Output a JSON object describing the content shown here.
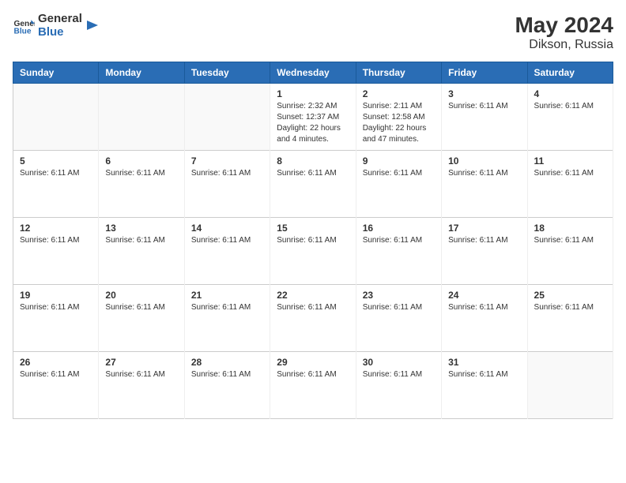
{
  "logo": {
    "text_general": "General",
    "text_blue": "Blue"
  },
  "title": {
    "month_year": "May 2024",
    "location": "Dikson, Russia"
  },
  "headers": [
    "Sunday",
    "Monday",
    "Tuesday",
    "Wednesday",
    "Thursday",
    "Friday",
    "Saturday"
  ],
  "weeks": [
    [
      {
        "day": "",
        "info": "",
        "empty": true
      },
      {
        "day": "",
        "info": "",
        "empty": true
      },
      {
        "day": "",
        "info": "",
        "empty": true
      },
      {
        "day": "1",
        "info": "Sunrise: 2:32 AM\nSunset: 12:37 AM\nDaylight: 22 hours and 4 minutes."
      },
      {
        "day": "2",
        "info": "Sunrise: 2:11 AM\nSunset: 12:58 AM\nDaylight: 22 hours and 47 minutes."
      },
      {
        "day": "3",
        "info": "Sunrise: 6:11 AM"
      },
      {
        "day": "4",
        "info": "Sunrise: 6:11 AM"
      }
    ],
    [
      {
        "day": "5",
        "info": "Sunrise: 6:11 AM"
      },
      {
        "day": "6",
        "info": "Sunrise: 6:11 AM"
      },
      {
        "day": "7",
        "info": "Sunrise: 6:11 AM"
      },
      {
        "day": "8",
        "info": "Sunrise: 6:11 AM"
      },
      {
        "day": "9",
        "info": "Sunrise: 6:11 AM"
      },
      {
        "day": "10",
        "info": "Sunrise: 6:11 AM"
      },
      {
        "day": "11",
        "info": "Sunrise: 6:11 AM"
      }
    ],
    [
      {
        "day": "12",
        "info": "Sunrise: 6:11 AM"
      },
      {
        "day": "13",
        "info": "Sunrise: 6:11 AM"
      },
      {
        "day": "14",
        "info": "Sunrise: 6:11 AM"
      },
      {
        "day": "15",
        "info": "Sunrise: 6:11 AM"
      },
      {
        "day": "16",
        "info": "Sunrise: 6:11 AM"
      },
      {
        "day": "17",
        "info": "Sunrise: 6:11 AM"
      },
      {
        "day": "18",
        "info": "Sunrise: 6:11 AM"
      }
    ],
    [
      {
        "day": "19",
        "info": "Sunrise: 6:11 AM"
      },
      {
        "day": "20",
        "info": "Sunrise: 6:11 AM"
      },
      {
        "day": "21",
        "info": "Sunrise: 6:11 AM"
      },
      {
        "day": "22",
        "info": "Sunrise: 6:11 AM"
      },
      {
        "day": "23",
        "info": "Sunrise: 6:11 AM"
      },
      {
        "day": "24",
        "info": "Sunrise: 6:11 AM"
      },
      {
        "day": "25",
        "info": "Sunrise: 6:11 AM"
      }
    ],
    [
      {
        "day": "26",
        "info": "Sunrise: 6:11 AM"
      },
      {
        "day": "27",
        "info": "Sunrise: 6:11 AM"
      },
      {
        "day": "28",
        "info": "Sunrise: 6:11 AM"
      },
      {
        "day": "29",
        "info": "Sunrise: 6:11 AM"
      },
      {
        "day": "30",
        "info": "Sunrise: 6:11 AM"
      },
      {
        "day": "31",
        "info": "Sunrise: 6:11 AM"
      },
      {
        "day": "",
        "info": "",
        "empty": true
      }
    ]
  ]
}
